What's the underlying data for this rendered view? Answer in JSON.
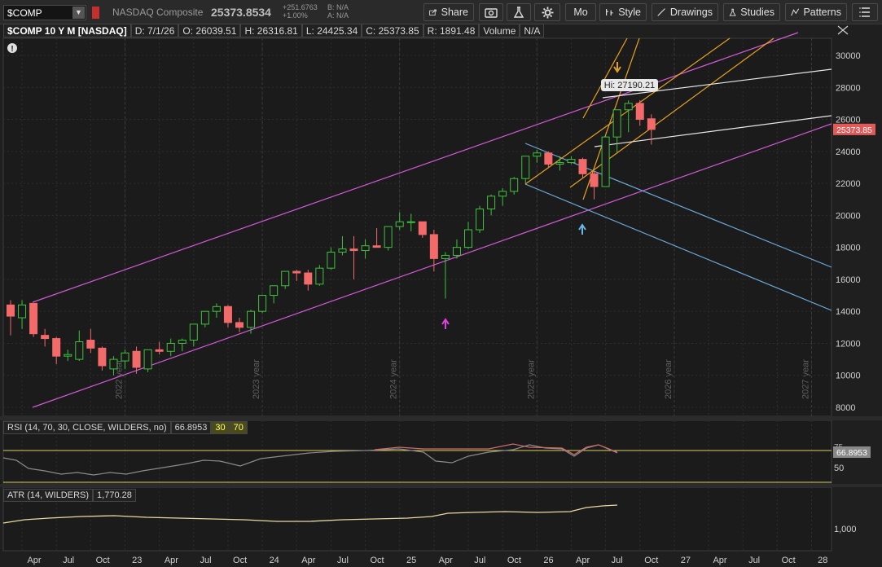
{
  "toolbar": {
    "symbol": "$COMP",
    "name": "NASDAQ Composite",
    "price": "25373.8534",
    "change_abs": "+251.6763",
    "change_pct": "+1.00%",
    "bid": "B: N/A",
    "ask": "A: N/A",
    "share_label": "Share",
    "timeframe_label": "Mo",
    "style_label": "Style",
    "drawings_label": "Drawings",
    "studies_label": "Studies",
    "patterns_label": "Patterns"
  },
  "info": {
    "title": "$COMP 10 Y M [NASDAQ]",
    "date": "D: 7/1/26",
    "open": "O: 26039.51",
    "high": "H: 26316.81",
    "low": "L: 24425.34",
    "close": "C: 25373.85",
    "range": "R: 1891.48",
    "volume_label": "Volume",
    "volume_value": "N/A"
  },
  "chart_data": {
    "type": "candlestick",
    "y_ticks": [
      "30000",
      "28000",
      "26000",
      "24000",
      "22000",
      "20000",
      "18000",
      "16000",
      "14000",
      "12000",
      "10000",
      "8000"
    ],
    "year_labels": [
      "2022 year",
      "2023 year",
      "2024 year",
      "2025 year",
      "2026 year",
      "2027 year"
    ],
    "x_labels": [
      "Apr",
      "Jul",
      "Oct",
      "23",
      "Apr",
      "Jul",
      "Oct",
      "24",
      "Apr",
      "Jul",
      "Oct",
      "25",
      "Apr",
      "Jul",
      "Oct",
      "26",
      "Apr",
      "Jul",
      "Oct",
      "27",
      "Apr",
      "Jul",
      "Oct",
      "28"
    ],
    "hi_label": "Hi: 27190.21",
    "last_price": "25373.85",
    "candles": [
      [
        14400,
        14700,
        12500,
        13700
      ],
      [
        13600,
        14700,
        12900,
        14400
      ],
      [
        14500,
        14500,
        12400,
        12600
      ],
      [
        12500,
        12900,
        11800,
        12300
      ],
      [
        12300,
        12400,
        10700,
        11200
      ],
      [
        11200,
        11600,
        10900,
        11300
      ],
      [
        11000,
        12800,
        10900,
        12100
      ],
      [
        12200,
        12900,
        11400,
        11700
      ],
      [
        11700,
        11800,
        10300,
        10600
      ],
      [
        10400,
        11200,
        10000,
        11000
      ],
      [
        10900,
        11600,
        10400,
        11400
      ],
      [
        11500,
        11800,
        10100,
        10500
      ],
      [
        10400,
        11600,
        10200,
        11600
      ],
      [
        11600,
        12100,
        11300,
        11500
      ],
      [
        11500,
        12300,
        11200,
        12000
      ],
      [
        12000,
        12300,
        11500,
        12200
      ],
      [
        12200,
        13200,
        11800,
        13200
      ],
      [
        13200,
        14000,
        13000,
        14000
      ],
      [
        14000,
        14500,
        13600,
        14300
      ],
      [
        14300,
        14400,
        13000,
        13300
      ],
      [
        13300,
        13600,
        12700,
        13000
      ],
      [
        13000,
        14100,
        12600,
        14000
      ],
      [
        14000,
        15000,
        13900,
        15000
      ],
      [
        15000,
        15600,
        14500,
        15600
      ],
      [
        15600,
        16500,
        15400,
        16500
      ],
      [
        16500,
        16600,
        15900,
        16400
      ],
      [
        16400,
        16600,
        15300,
        15700
      ],
      [
        15700,
        16900,
        15600,
        16700
      ],
      [
        16700,
        18000,
        16600,
        17700
      ],
      [
        17700,
        18700,
        17500,
        17900
      ],
      [
        17900,
        18700,
        16000,
        17800
      ],
      [
        17800,
        18500,
        17300,
        18100
      ],
      [
        18100,
        19200,
        18000,
        18000
      ],
      [
        18000,
        19300,
        17800,
        19300
      ],
      [
        19300,
        20200,
        19100,
        19600
      ],
      [
        19600,
        20100,
        19000,
        19600
      ],
      [
        19600,
        19600,
        18600,
        18800
      ],
      [
        18800,
        19100,
        16500,
        17300
      ],
      [
        17300,
        17700,
        14800,
        17500
      ],
      [
        17500,
        18500,
        17300,
        18000
      ],
      [
        18000,
        19600,
        17900,
        19100
      ],
      [
        19100,
        20600,
        18900,
        20400
      ],
      [
        20400,
        21300,
        20000,
        21200
      ],
      [
        21200,
        21700,
        20600,
        21500
      ],
      [
        21500,
        22400,
        21300,
        22300
      ],
      [
        22300,
        23700,
        22000,
        23700
      ],
      [
        23700,
        24100,
        23300,
        23900
      ],
      [
        23900,
        24000,
        23000,
        23200
      ],
      [
        23200,
        23700,
        22800,
        23300
      ],
      [
        23300,
        23700,
        23200,
        23500
      ],
      [
        23500,
        23600,
        22300,
        22600
      ],
      [
        22600,
        22800,
        21000,
        21800
      ],
      [
        21800,
        25000,
        21800,
        24900
      ],
      [
        24900,
        26600,
        23900,
        26600
      ],
      [
        26600,
        27190,
        25200,
        27000
      ],
      [
        27000,
        27200,
        25600,
        26000
      ],
      [
        26040,
        26317,
        24425,
        25374
      ]
    ],
    "rsi_label": "RSI (14, 70, 30, CLOSE, WILDERS, no)",
    "rsi_value": "66.8953",
    "rsi_levels": [
      "30",
      "70"
    ],
    "rsi_ticks": [
      "75",
      "50"
    ],
    "atr_label": "ATR (14, WILDERS)",
    "atr_value": "1,770.28",
    "atr_tick": "1,000"
  },
  "colors": {
    "up": "#3ec23e",
    "down": "#f26a6a",
    "channel": "#d35ad8",
    "blue": "#6aa8d8",
    "orange": "#e6a020",
    "white": "#e8e8e8"
  }
}
